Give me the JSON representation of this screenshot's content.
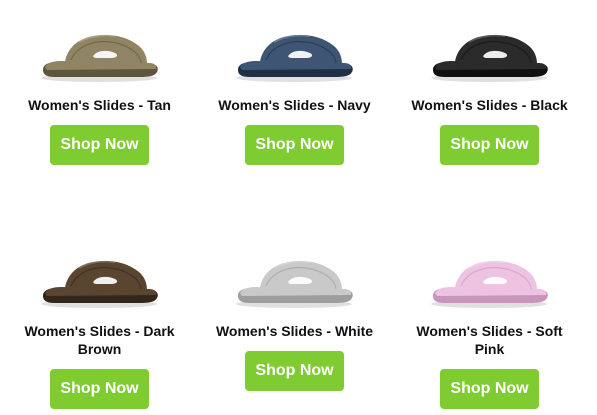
{
  "products": [
    {
      "name": "Women's Slides - Tan",
      "button_label": "Shop Now",
      "color": "#8f8564",
      "shade": "#5e563c",
      "icon": "slide-sandal-icon"
    },
    {
      "name": "Women's Slides - Navy",
      "button_label": "Shop Now",
      "color": "#3e5674",
      "shade": "#1f2f45",
      "icon": "slide-sandal-icon"
    },
    {
      "name": "Women's Slides - Black",
      "button_label": "Shop Now",
      "color": "#2b2b2b",
      "shade": "#0f0f0f",
      "icon": "slide-sandal-icon"
    },
    {
      "name": "Women's Slides - Dark Brown",
      "button_label": "Shop Now",
      "color": "#5a4530",
      "shade": "#33261a",
      "icon": "slide-sandal-icon"
    },
    {
      "name": "Women's Slides - White",
      "button_label": "Shop Now",
      "color": "#c9c9c9",
      "shade": "#9d9d9d",
      "icon": "slide-sandal-icon"
    },
    {
      "name": "Women's Slides - Soft Pink",
      "button_label": "Shop Now",
      "color": "#eec3e2",
      "shade": "#c896bb",
      "icon": "slide-sandal-icon"
    }
  ],
  "button_color": "#7fcb32"
}
